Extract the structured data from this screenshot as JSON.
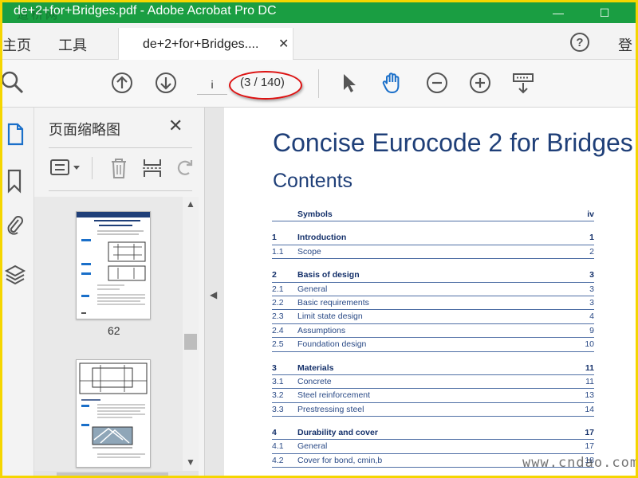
{
  "window": {
    "title": "de+2+for+Bridges.pdf - Adobe Acrobat Pro DC",
    "watermark": "道桥网",
    "min_glyph": "—",
    "max_glyph": "☐"
  },
  "tabs": {
    "home": "主页",
    "tools": "工具",
    "doc_tab": "de+2+for+Bridges....",
    "close": "✕",
    "help": "?",
    "login": "登"
  },
  "toolbar": {
    "page_value": "i",
    "page_count": "(3 / 140)"
  },
  "thumbnails": {
    "title": "页面缩略图",
    "close": "✕",
    "page_label": "62",
    "scroll_up": "▲",
    "scroll_down": "▼"
  },
  "collapse_arrow": "◀",
  "document": {
    "title": "Concise Eurocode 2 for Bridges",
    "subtitle": "Contents",
    "toc": [
      {
        "num": "",
        "text": "Symbols",
        "page": "iv",
        "head": true
      },
      {
        "gap": true
      },
      {
        "num": "1",
        "text": "Introduction",
        "page": "1",
        "head": true
      },
      {
        "num": "1.1",
        "text": "Scope",
        "page": "2",
        "head": false
      },
      {
        "gap": true
      },
      {
        "num": "2",
        "text": "Basis of design",
        "page": "3",
        "head": true
      },
      {
        "num": "2.1",
        "text": "General",
        "page": "3",
        "head": false
      },
      {
        "num": "2.2",
        "text": "Basic requirements",
        "page": "3",
        "head": false
      },
      {
        "num": "2.3",
        "text": "Limit state design",
        "page": "4",
        "head": false
      },
      {
        "num": "2.4",
        "text": "Assumptions",
        "page": "9",
        "head": false
      },
      {
        "num": "2.5",
        "text": "Foundation design",
        "page": "10",
        "head": false
      },
      {
        "gap": true
      },
      {
        "num": "3",
        "text": "Materials",
        "page": "11",
        "head": true
      },
      {
        "num": "3.1",
        "text": "Concrete",
        "page": "11",
        "head": false
      },
      {
        "num": "3.2",
        "text": "Steel reinforcement",
        "page": "13",
        "head": false
      },
      {
        "num": "3.3",
        "text": "Prestressing steel",
        "page": "14",
        "head": false
      },
      {
        "gap": true
      },
      {
        "num": "4",
        "text": "Durability and cover",
        "page": "17",
        "head": true
      },
      {
        "num": "4.1",
        "text": "General",
        "page": "17",
        "head": false
      },
      {
        "num": "4.2",
        "text": "Cover for bond, cmin,b",
        "page": "18",
        "head": false
      }
    ]
  },
  "site_watermark": "www.cndao.com"
}
